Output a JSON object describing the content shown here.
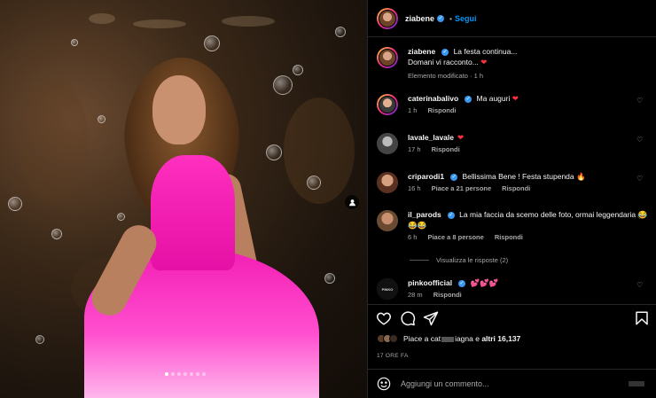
{
  "post": {
    "author": "ziabene",
    "follow_label": "Segui",
    "caption_line1": "La festa continua...",
    "caption_line2": "Domani vi racconto...",
    "caption_meta": "Elemento modificato · 1 h"
  },
  "comments": [
    {
      "user": "caterinabalivo",
      "text": "Ma auguri",
      "time": "1 h",
      "likes": "",
      "reply": "Rispondi",
      "verified": true
    },
    {
      "user": "lavale_lavale",
      "text": "",
      "time": "17 h",
      "likes": "",
      "reply": "Rispondi",
      "verified": false
    },
    {
      "user": "criparodi1",
      "text": "Bellissima Bene ! Festa stupenda",
      "time": "16 h",
      "likes": "Piace a 21 persone",
      "reply": "Rispondi",
      "verified": true
    },
    {
      "user": "il_parods",
      "text": "La mia faccia da scemo delle foto, ormai leggendaria",
      "time": "6 h",
      "likes": "Piace a 8 persone",
      "reply": "Rispondi",
      "verified": true
    },
    {
      "user": "pinkoofficial",
      "text": "",
      "time": "28 m",
      "likes": "",
      "reply": "Rispondi",
      "verified": true
    }
  ],
  "view_replies": "Visualizza le risposte (2)",
  "likes_prefix": "Piace a cat",
  "likes_name_tail": "iagna",
  "likes_suffix": " e ",
  "likes_count": "altri 16,137",
  "timestamp": "17 ORE FA",
  "comment_input": {
    "placeholder": "Aggiungi un commento...",
    "value": ""
  },
  "publish_label": "Pubblica",
  "icons": {
    "heart": "heart-icon",
    "comment": "comment-icon",
    "share": "share-icon",
    "save": "bookmark-icon",
    "emoji": "emoji-icon",
    "verified": "verified-badge-icon",
    "tag": "tag-people-icon"
  },
  "colors": {
    "accent": "#0095f6",
    "verified": "#3897f0",
    "dress": "#f31db4",
    "heart": "#ff3040"
  }
}
